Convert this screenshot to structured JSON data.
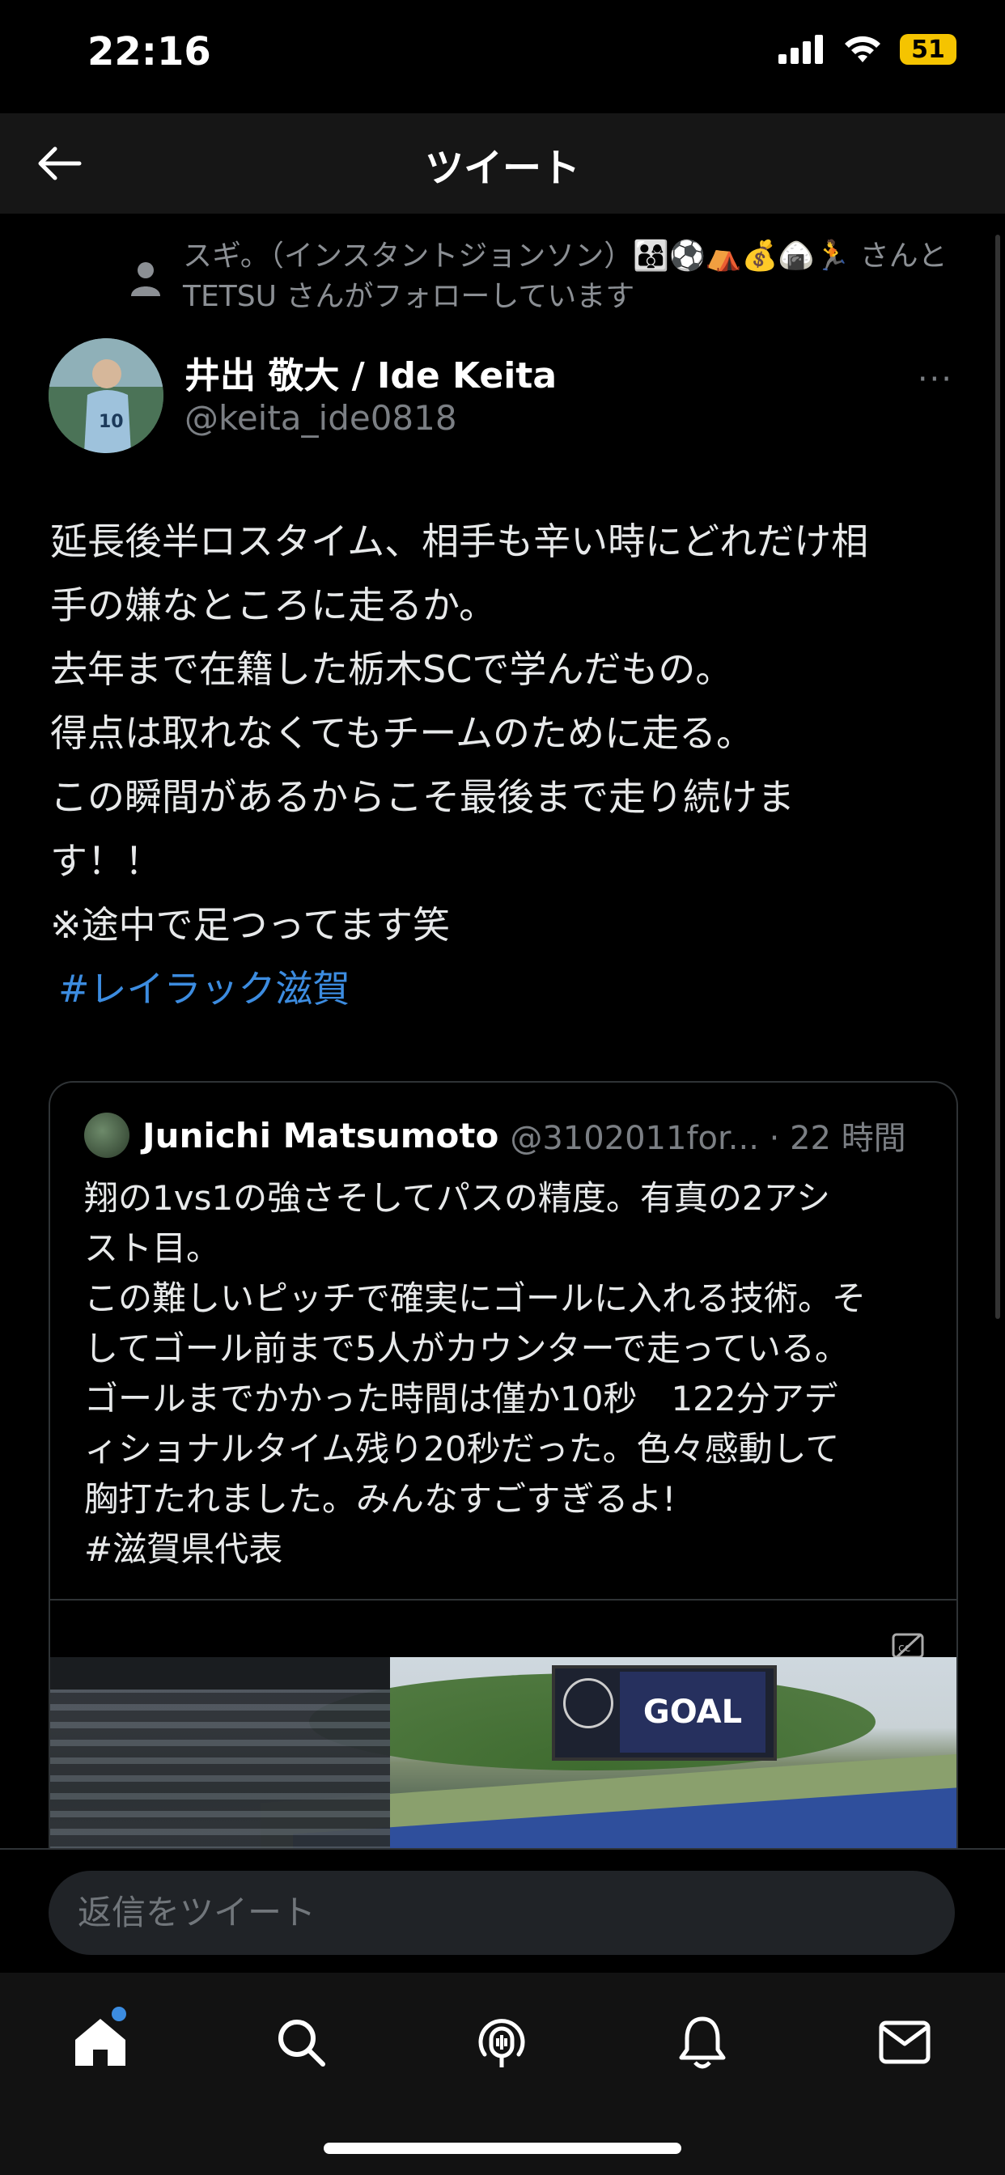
{
  "status_bar": {
    "time": "22:16",
    "battery": "51"
  },
  "nav": {
    "title": "ツイート"
  },
  "social_context": {
    "text": "スギ。（インスタントジョンソン）👨‍👩‍👦⚽️⛺️💰🍙🏃 さんと TETSU さんがフォローしています"
  },
  "author": {
    "name": "井出 敬大 / Ide Keita",
    "handle": "@keita_ide0818",
    "more": "···"
  },
  "tweet": {
    "lines": [
      "延長後半ロスタイム、相手も辛い時にどれだけ相",
      "手の嫌なところに走るか。",
      "去年まで在籍した栃木SCで学んだもの。",
      "得点は取れなくてもチームのために走る。",
      "この瞬間があるからこそ最後まで走り続けま",
      "す！！",
      "※途中で足つってます笑"
    ],
    "hashtag": "#レイラック滋賀"
  },
  "quote": {
    "name": "Junichi Matsumoto",
    "handle_time": "@3102011for... · 22 時間",
    "lines": [
      "翔の1vs1の強さそしてパスの精度。有真の2アシ",
      "スト目。",
      "この難しいピッチで確実にゴールに入れる技術。そ",
      "してゴール前まで5人がカウンターで走っている。",
      "ゴールまでかかった時間は僅か10秒　122分アデ",
      "ィショナルタイム残り20秒だった。色々感動して",
      "胸打たれました。みんなすごすぎるよ!",
      "#滋賀県代表"
    ],
    "media": {
      "scoreboard_text": "GOAL"
    }
  },
  "reply": {
    "placeholder": "返信をツイート"
  },
  "tabs": [
    "home-icon",
    "search-icon",
    "spaces-icon",
    "notifications-icon",
    "messages-icon"
  ],
  "colors": {
    "accent": "#3c8ce0",
    "background": "#000000",
    "battery": "#f5c400"
  }
}
